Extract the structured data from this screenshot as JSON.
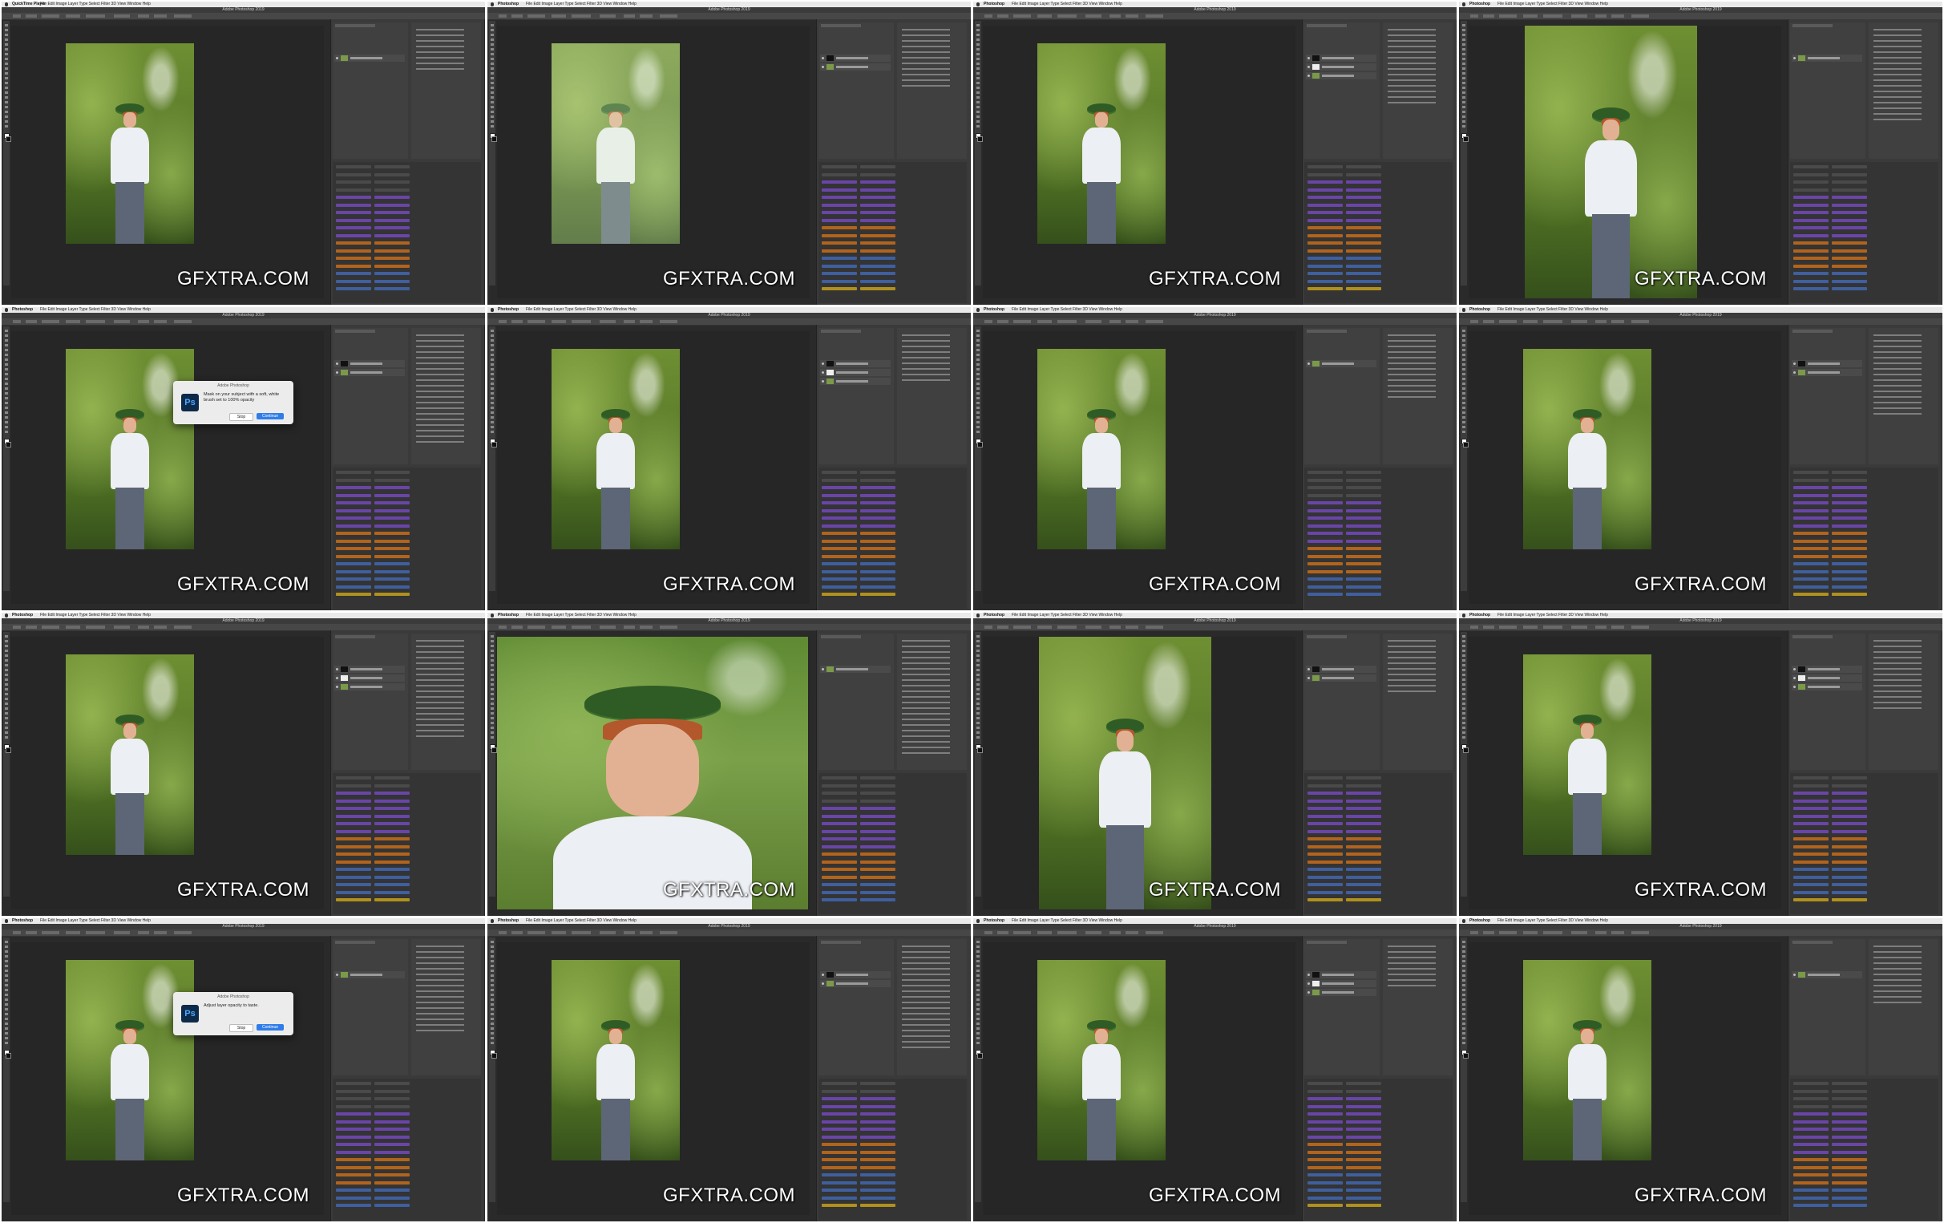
{
  "watermark": "GFXTRA.COM",
  "menu_items": [
    "File",
    "Edit",
    "Image",
    "Layer",
    "Type",
    "Select",
    "Filter",
    "3D",
    "View",
    "Window",
    "Help"
  ],
  "colors": {
    "menubar": "#e9e9e9",
    "ps_panel": "#3a3a3a",
    "canvas": "#262626",
    "action_orange": "#b2641c",
    "action_purple": "#6a45a8",
    "action_blue": "#3f5f9e",
    "action_gold": "#b0901e",
    "action_gray": "#4a4a4a"
  },
  "dialogs": {
    "mask_prompt": {
      "title": "Adobe Photoshop",
      "message": "Mask on your subject with a soft, white brush set to 100% opacity",
      "cancel": "Stop",
      "continue": "Continue"
    },
    "opacity_prompt": {
      "title": "Adobe Photoshop",
      "message": "Adjust layer opacity to taste.",
      "cancel": "Stop",
      "continue": "Continue"
    }
  },
  "thumbnails": [
    {
      "app": "QuickTime Player",
      "title": "Adobe Photoshop 2019",
      "variant": "normal"
    },
    {
      "app": "Photoshop",
      "title": "Adobe Photoshop 2019",
      "variant": "faded"
    },
    {
      "app": "Photoshop",
      "title": "Adobe Photoshop 2019",
      "variant": "normal"
    },
    {
      "app": "Photoshop",
      "title": "Adobe Photoshop 2019",
      "variant": "large"
    },
    {
      "app": "Photoshop",
      "title": "Adobe Photoshop 2019",
      "variant": "normal",
      "dialog": "mask_prompt"
    },
    {
      "app": "Photoshop",
      "title": "Adobe Photoshop 2019",
      "variant": "normal"
    },
    {
      "app": "Photoshop",
      "title": "Adobe Photoshop 2019",
      "variant": "normal"
    },
    {
      "app": "Photoshop",
      "title": "Adobe Photoshop 2019",
      "variant": "normal"
    },
    {
      "app": "Photoshop",
      "title": "Adobe Photoshop 2019",
      "variant": "normal"
    },
    {
      "app": "Photoshop",
      "title": "Adobe Photoshop 2019",
      "variant": "closeup"
    },
    {
      "app": "Photoshop",
      "title": "Adobe Photoshop 2019",
      "variant": "large"
    },
    {
      "app": "Photoshop",
      "title": "Adobe Photoshop 2019",
      "variant": "normal"
    },
    {
      "app": "Photoshop",
      "title": "Adobe Photoshop 2019",
      "variant": "normal",
      "dialog": "opacity_prompt"
    },
    {
      "app": "Photoshop",
      "title": "Adobe Photoshop 2019",
      "variant": "normal"
    },
    {
      "app": "Photoshop",
      "title": "Adobe Photoshop 2019",
      "variant": "normal"
    },
    {
      "app": "Photoshop",
      "title": "Adobe Photoshop 2019",
      "variant": "normal"
    }
  ]
}
